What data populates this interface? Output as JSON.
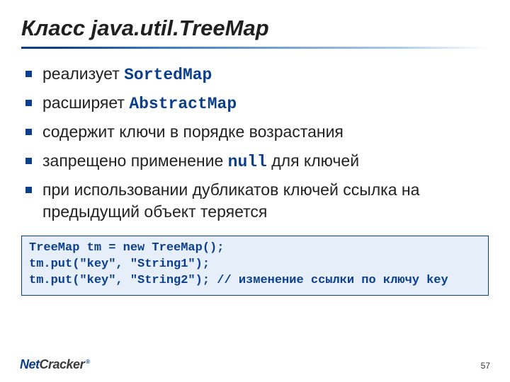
{
  "title": "Класс java.util.TreeMap",
  "bullets": [
    {
      "prefix": "реализует ",
      "code": "SortedMap",
      "suffix": ""
    },
    {
      "prefix": "расширяет ",
      "code": "AbstractMap",
      "suffix": ""
    },
    {
      "prefix": "содержит ключи в порядке возрастания",
      "code": "",
      "suffix": ""
    },
    {
      "prefix": "запрещено применение ",
      "code": "null",
      "suffix": " для ключей"
    },
    {
      "prefix": "при использовании дубликатов ключей ссылка на предыдущий объект теряется",
      "code": "",
      "suffix": ""
    }
  ],
  "code_block": "TreeMap tm = new TreeMap();\ntm.put(\"key\", \"String1\");\ntm.put(\"key\", \"String2\"); // изменение ссылки по ключу key",
  "logo": {
    "part1": "Net",
    "part2": "Cracker",
    "reg": "®"
  },
  "page_number": "57"
}
